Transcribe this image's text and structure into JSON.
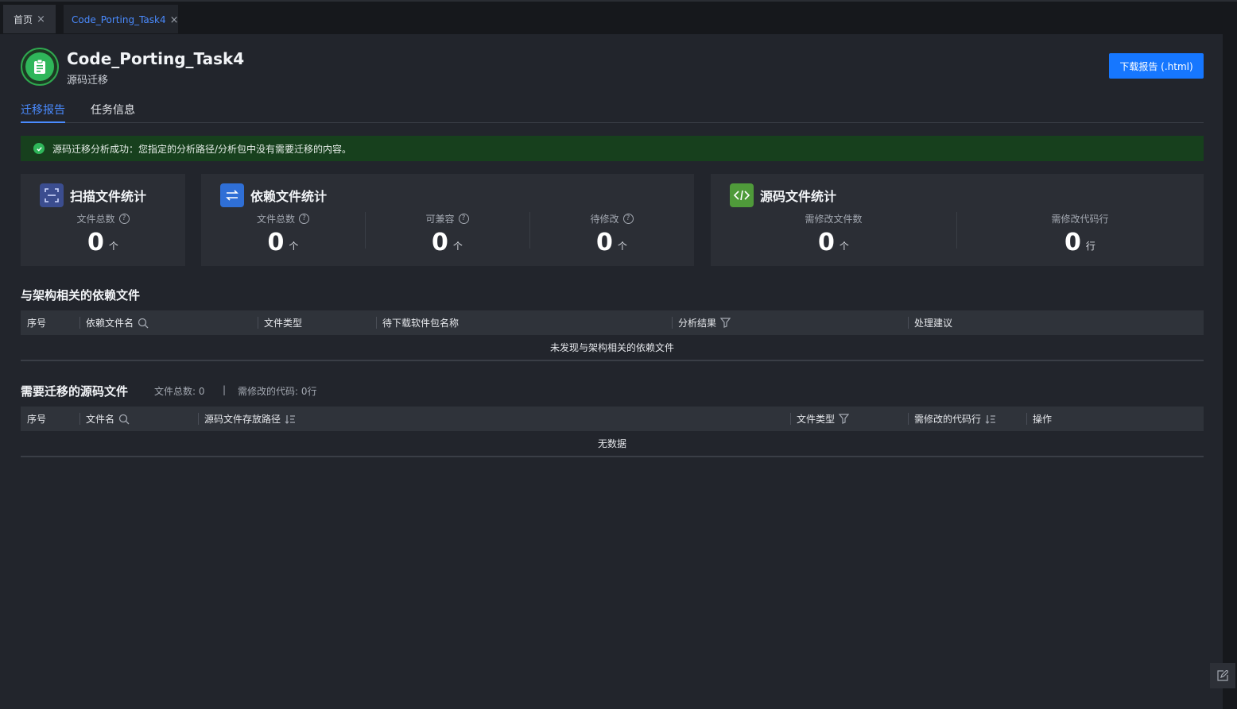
{
  "tabs": [
    {
      "label": "首页"
    },
    {
      "label": "Code_Porting_Task4"
    }
  ],
  "header": {
    "title": "Code_Porting_Task4",
    "subtitle": "源码迁移",
    "download_label": "下载报告 (.html)"
  },
  "subtabs": [
    {
      "label": "迁移报告",
      "active": true
    },
    {
      "label": "任务信息",
      "active": false
    }
  ],
  "alert": {
    "text": "源码迁移分析成功：您指定的分析路径/分析包中没有需要迁移的内容。"
  },
  "cards": {
    "scan": {
      "title": "扫描文件统计",
      "stats": [
        {
          "label": "文件总数",
          "value": "0",
          "unit": "个"
        }
      ]
    },
    "dep": {
      "title": "依赖文件统计",
      "stats": [
        {
          "label": "文件总数",
          "value": "0",
          "unit": "个"
        },
        {
          "label": "可兼容",
          "value": "0",
          "unit": "个"
        },
        {
          "label": "待修改",
          "value": "0",
          "unit": "个"
        }
      ]
    },
    "src": {
      "title": "源码文件统计",
      "stats": [
        {
          "label": "需修改文件数",
          "value": "0",
          "unit": "个"
        },
        {
          "label": "需修改代码行",
          "value": "0",
          "unit": "行"
        }
      ]
    }
  },
  "dep_table": {
    "title": "与架构相关的依赖文件",
    "columns": [
      "序号",
      "依赖文件名",
      "文件类型",
      "待下载软件包名称",
      "分析结果",
      "处理建议"
    ],
    "empty_text": "未发现与架构相关的依赖文件"
  },
  "src_table": {
    "title": "需要迁移的源码文件",
    "meta_total": "文件总数: 0",
    "meta_sep": "|",
    "meta_lines": "需修改的代码: 0行",
    "columns": [
      "序号",
      "文件名",
      "源码文件存放路径",
      "文件类型",
      "需修改的代码行",
      "操作"
    ],
    "empty_text": "无数据"
  },
  "colors": {
    "accent": "#1677ff",
    "success": "#2fb65a",
    "alert_bg": "#17401d"
  }
}
